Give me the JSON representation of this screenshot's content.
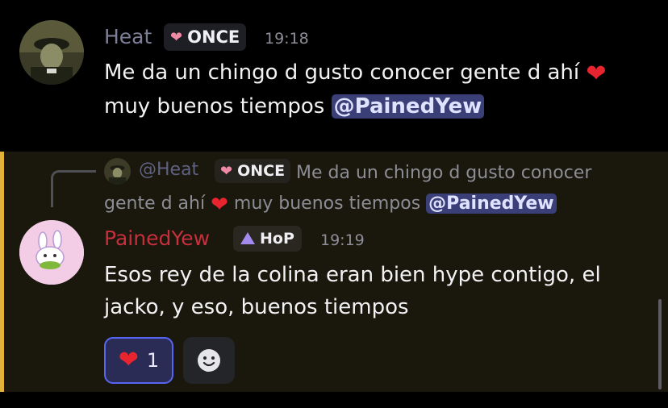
{
  "messages": [
    {
      "author": "Heat",
      "role_tag": "ONCE",
      "time": "19:18",
      "text_line1": "Me da un chingo d gusto conocer gente d ahí",
      "text_line2": "muy buenos tiempos",
      "mention": "@PainedYew"
    },
    {
      "reply": {
        "author": "@Heat",
        "role_tag": "ONCE",
        "text_part1": "Me da un chingo d gusto conocer gente d ahí",
        "text_part2": "muy buenos tiempos",
        "mention": "@PainedYew"
      },
      "author": "PainedYew",
      "role_tag": "HoP",
      "time": "19:19",
      "text": "Esos rey de la colina eran bien hype contigo, el jacko, y eso, buenos tiempos",
      "reactions": [
        {
          "emoji": "heart",
          "count": "1"
        }
      ]
    }
  ],
  "icons": {
    "role_ONCE": "pink-heart-icon",
    "role_HoP": "purple-gem-icon",
    "add_reaction": "smiley-add-reaction-icon"
  },
  "colors": {
    "mention_bg": "#3a3f78",
    "highlight_bar": "#e1b23a",
    "highlight_bg": "#1a170c",
    "author2": "#c62f3c",
    "author1": "#7d7f99",
    "reaction_border": "#5865f2"
  }
}
